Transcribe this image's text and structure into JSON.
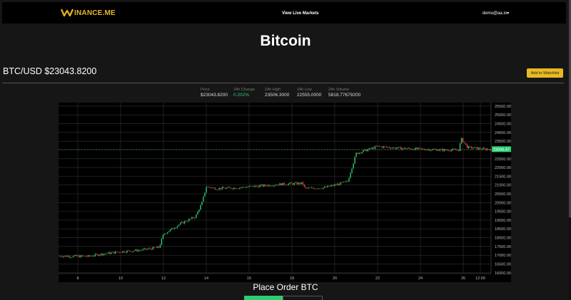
{
  "nav": {
    "brand": "INANCE.ME",
    "center_link": "View Live Markets",
    "user": "demo@aa.io▾"
  },
  "page": {
    "title": "Bitcoin",
    "pair": "BTC/USD $23043.8200",
    "watchlist_button": "Add to Watchlist"
  },
  "stats": [
    {
      "label": "Price",
      "value": "$23043.8200"
    },
    {
      "label": "24h Change",
      "value": "0.202%"
    },
    {
      "label": "24h High",
      "value": "23506.3000"
    },
    {
      "label": "24h Low",
      "value": "22555.0000"
    },
    {
      "label": "24h Volume",
      "value": "5818.77679200"
    }
  ],
  "order": {
    "title": "Place Order BTC"
  },
  "colors": {
    "brand": "#e8b923",
    "up": "#2ecc71",
    "down": "#e74c3c",
    "grid": "#333333"
  },
  "chart_data": {
    "type": "candlestick",
    "x_tick_labels": [
      "8",
      "10",
      "12",
      "14",
      "16",
      "18",
      "20",
      "22",
      "24",
      "26",
      "12:00"
    ],
    "y_tick_labels": [
      "16000.00",
      "16500.00",
      "17000.00",
      "17500.00",
      "18000.00",
      "18500.00",
      "19000.00",
      "19500.00",
      "20000.00",
      "20500.00",
      "21000.00",
      "21500.00",
      "22000.00",
      "22500.00",
      "23000.00",
      "23500.00",
      "24000.00",
      "24500.00",
      "25000.00",
      "25500.00"
    ],
    "ylim": [
      15950,
      25700
    ],
    "x_range_days": [
      7.1,
      27.3
    ],
    "last_price_label": "23046.47",
    "last_price": 23046.47,
    "grid": true,
    "approx_close_path": [
      [
        7.1,
        16950
      ],
      [
        8.5,
        16930
      ],
      [
        9.0,
        17050
      ],
      [
        10.0,
        17200
      ],
      [
        11.0,
        17300
      ],
      [
        11.8,
        17450
      ],
      [
        12.0,
        18200
      ],
      [
        12.8,
        18800
      ],
      [
        13.5,
        19200
      ],
      [
        13.8,
        20000
      ],
      [
        14.0,
        20900
      ],
      [
        14.5,
        20800
      ],
      [
        15.5,
        20850
      ],
      [
        16.5,
        20950
      ],
      [
        17.5,
        21050
      ],
      [
        18.5,
        21100
      ],
      [
        18.6,
        20800
      ],
      [
        19.5,
        20850
      ],
      [
        20.0,
        21000
      ],
      [
        20.6,
        21200
      ],
      [
        21.0,
        22800
      ],
      [
        22.0,
        23200
      ],
      [
        23.0,
        23100
      ],
      [
        24.0,
        23050
      ],
      [
        25.0,
        23000
      ],
      [
        25.8,
        23000
      ],
      [
        25.9,
        23650
      ],
      [
        26.2,
        23150
      ],
      [
        27.0,
        23050
      ],
      [
        27.3,
        23046
      ]
    ]
  }
}
